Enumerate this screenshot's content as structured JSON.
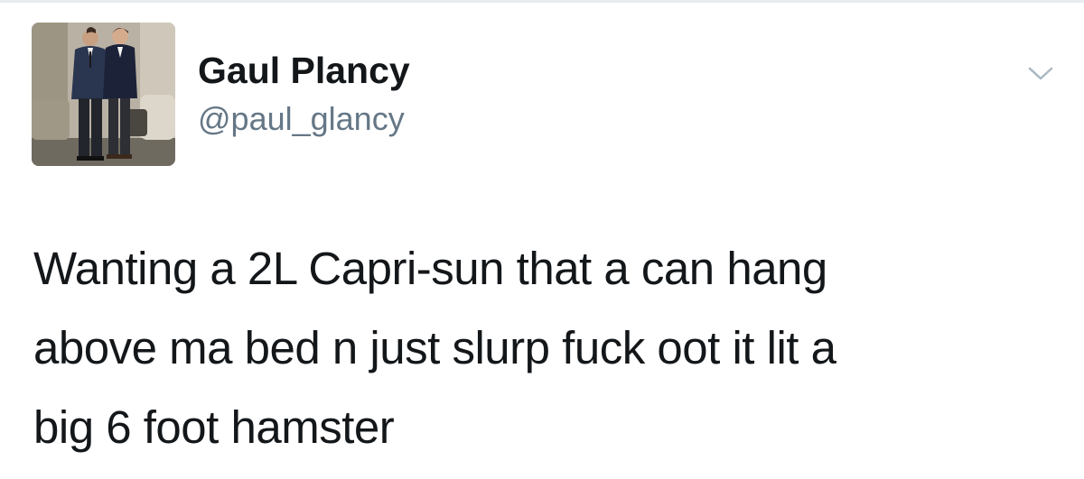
{
  "tweet": {
    "author": {
      "display_name": "Gaul Plancy",
      "handle": "@paul_glancy",
      "avatar": "profile-photo"
    },
    "menu_icon": "chevron-down-icon",
    "text_lines": [
      "Wanting a 2L Capri-sun that a can hang",
      "above ma bed n just slurp fuck oot it lit a",
      "big 6 foot hamster"
    ]
  },
  "colors": {
    "text": "#14171a",
    "secondary_text": "#657786",
    "caret": "#aab8c2",
    "background": "#ffffff"
  }
}
